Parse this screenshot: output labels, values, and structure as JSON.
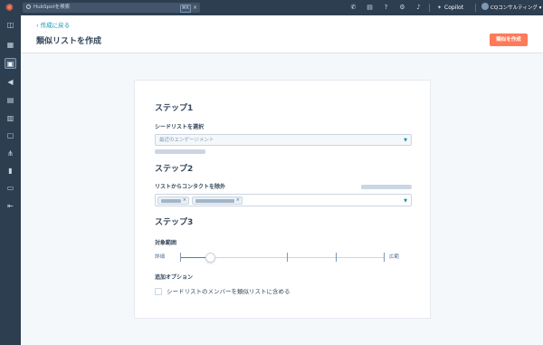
{
  "topbar": {
    "search_placeholder": "HubSpotを検索",
    "search_shortcut": "⌘K",
    "copilot_label": "Copilot",
    "account_name": "CQコンサルティング"
  },
  "header": {
    "back_link": "作成に戻る",
    "title": "類似リストを作成",
    "create_button": "類似を作成"
  },
  "step1": {
    "title": "ステップ1",
    "label": "シードリストを選択",
    "select_value": "最近のエンゲージメント"
  },
  "step2": {
    "title": "ステップ2",
    "label": "リストからコンタクトを除外"
  },
  "step3": {
    "title": "ステップ3",
    "range_label": "対象範囲",
    "range_min_label": "詳細",
    "range_max_label": "広範",
    "range_value": 0.15,
    "options_label": "追加オプション",
    "checkbox_label": "シードリストのメンバーを類似リストに含める",
    "checkbox_checked": false
  },
  "colors": {
    "accent": "#ff7a59",
    "link": "#0091ae",
    "nav": "#2d3e50"
  }
}
